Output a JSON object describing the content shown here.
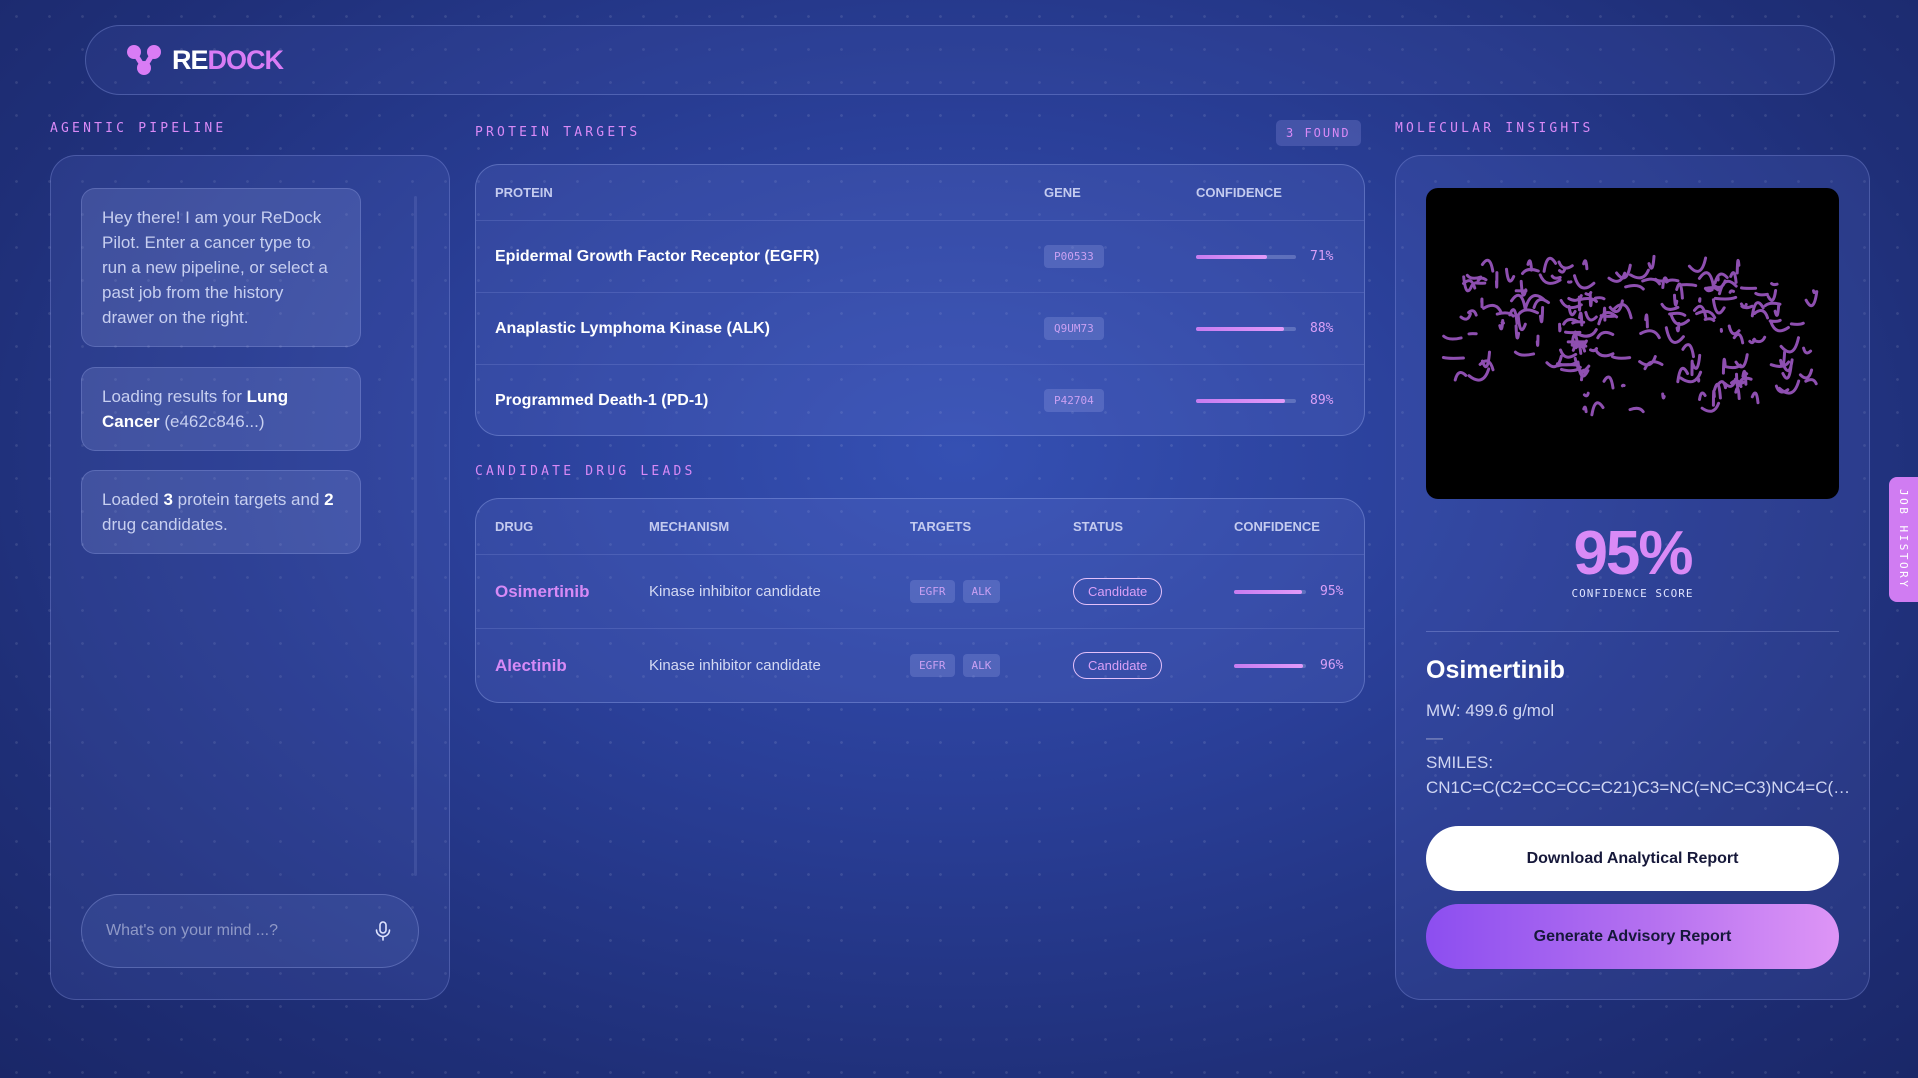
{
  "brand": {
    "name_part1": "RE",
    "name_part2": "DOCK",
    "accent": "#d97cf5"
  },
  "pipeline": {
    "section_label": "AGENTIC PIPELINE",
    "messages": [
      {
        "text": "Hey there! I am your ReDock Pilot. Enter a cancer type to run a new pipeline, or select a past job from the history drawer on the right."
      },
      {
        "prefix": "Loading results for ",
        "bold": "Lung Cancer",
        "suffix": " (e462c846...)"
      },
      {
        "bold1": "3",
        "mid": " protein targets and ",
        "bold2": "2",
        "prefix": "Loaded ",
        "suffix": " drug candidates."
      }
    ],
    "input_placeholder": "What's on your mind ...?",
    "mic_icon": "microphone-icon"
  },
  "protein_targets": {
    "section_label": "PROTEIN TARGETS",
    "found_badge": "3 FOUND",
    "headers": {
      "protein": "PROTEIN",
      "gene": "GENE",
      "confidence": "CONFIDENCE"
    },
    "rows": [
      {
        "protein": "Epidermal Growth Factor Receptor (EGFR)",
        "gene": "P00533",
        "confidence": 0.71,
        "confidence_label": "71%"
      },
      {
        "protein": "Anaplastic Lymphoma Kinase (ALK)",
        "gene": "Q9UM73",
        "confidence": 0.88,
        "confidence_label": "88%"
      },
      {
        "protein": "Programmed Death-1 (PD-1)",
        "gene": "P42704",
        "confidence": 0.89,
        "confidence_label": "89%"
      }
    ]
  },
  "drug_leads": {
    "section_label": "CANDIDATE DRUG LEADS",
    "headers": {
      "drug": "DRUG",
      "mechanism": "MECHANISM",
      "targets": "TARGETS",
      "status": "STATUS",
      "confidence": "CONFIDENCE"
    },
    "rows": [
      {
        "drug": "Osimertinib",
        "mechanism": "Kinase inhibitor candidate",
        "targets": [
          "EGFR",
          "ALK"
        ],
        "status": "Candidate",
        "confidence": 0.95,
        "confidence_label": "95%"
      },
      {
        "drug": "Alectinib",
        "mechanism": "Kinase inhibitor candidate",
        "targets": [
          "EGFR",
          "ALK"
        ],
        "status": "Candidate",
        "confidence": 0.96,
        "confidence_label": "96%"
      }
    ]
  },
  "insights": {
    "section_label": "MOLECULAR INSIGHTS",
    "score": "95%",
    "score_label": "CONFIDENCE SCORE",
    "molecule_name": "Osimertinib",
    "mw": "MW: 499.6 g/mol",
    "dash": "—",
    "smiles_label": "SMILES:",
    "smiles": "CN1C=C(C2=CC=CC=C21)C3=NC(=NC=C3)NC4=C(C...",
    "download_button": "Download Analytical Report",
    "advisory_button": "Generate Advisory Report",
    "protein_color": "#8e4fb0"
  },
  "history_tab": "JOB HISTORY"
}
